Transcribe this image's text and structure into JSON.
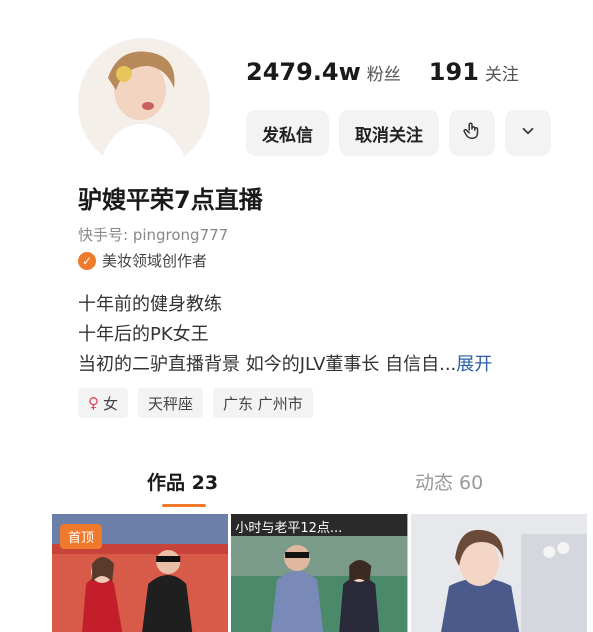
{
  "profile": {
    "fans_count": "2479.4w",
    "fans_label": "粉丝",
    "following_count": "191",
    "following_label": "关注",
    "message_button": "发私信",
    "unfollow_button": "取消关注",
    "name": "驴嫂平荣7点直播",
    "kuaishou_id": "快手号: pingrong777",
    "certification": "美妆领域创作者",
    "bio_lines": [
      "十年前的健身教练",
      "十年后的PK女王",
      "当初的二驴直播背景 如今的JLV董事长 自信自..."
    ],
    "expand_label": "展开",
    "tags": [
      "女",
      "天秤座",
      "广东 广州市"
    ]
  },
  "tabs": [
    {
      "label": "作品 23"
    },
    {
      "label": "动态 60"
    }
  ],
  "grid": {
    "pinned_badge": "首顶",
    "banner_text": "小时与老平12点..."
  },
  "colors": {
    "accent": "#f07a2b",
    "link": "#2a5fa8"
  },
  "icons": [
    "hand-icon",
    "chevron-down-icon",
    "female-icon",
    "verified-icon"
  ]
}
